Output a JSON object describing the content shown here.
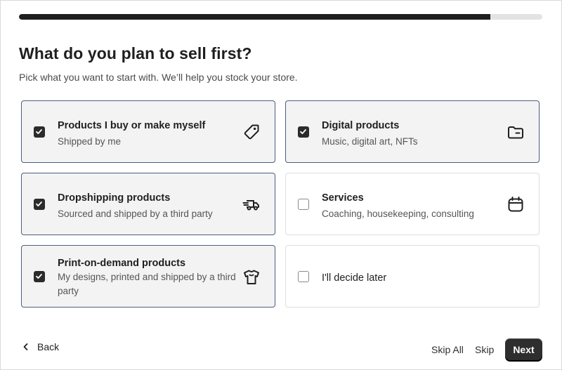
{
  "progress": {
    "fraction": 0.9
  },
  "header": {
    "title": "What do you plan to sell first?",
    "subtitle": "Pick what you want to start with. We’ll help you stock your store."
  },
  "options": [
    {
      "title": "Products I buy or make myself",
      "description": "Shipped by me",
      "checked": true,
      "icon": "tag-icon"
    },
    {
      "title": "Digital products",
      "description": "Music, digital art, NFTs",
      "checked": true,
      "icon": "folder-icon"
    },
    {
      "title": "Dropshipping products",
      "description": "Sourced and shipped by a third party",
      "checked": true,
      "icon": "delivery-truck-icon"
    },
    {
      "title": "Services",
      "description": "Coaching, housekeeping, consulting",
      "checked": false,
      "icon": "calendar-icon"
    },
    {
      "title": "Print-on-demand products",
      "description": "My designs, printed and shipped by a third party",
      "checked": true,
      "icon": "tshirt-icon"
    },
    {
      "title": "I'll decide later",
      "description": "",
      "checked": false,
      "icon": ""
    }
  ],
  "footer": {
    "back_label": "Back",
    "skip_all_label": "Skip All",
    "skip_label": "Skip",
    "next_label": "Next"
  }
}
